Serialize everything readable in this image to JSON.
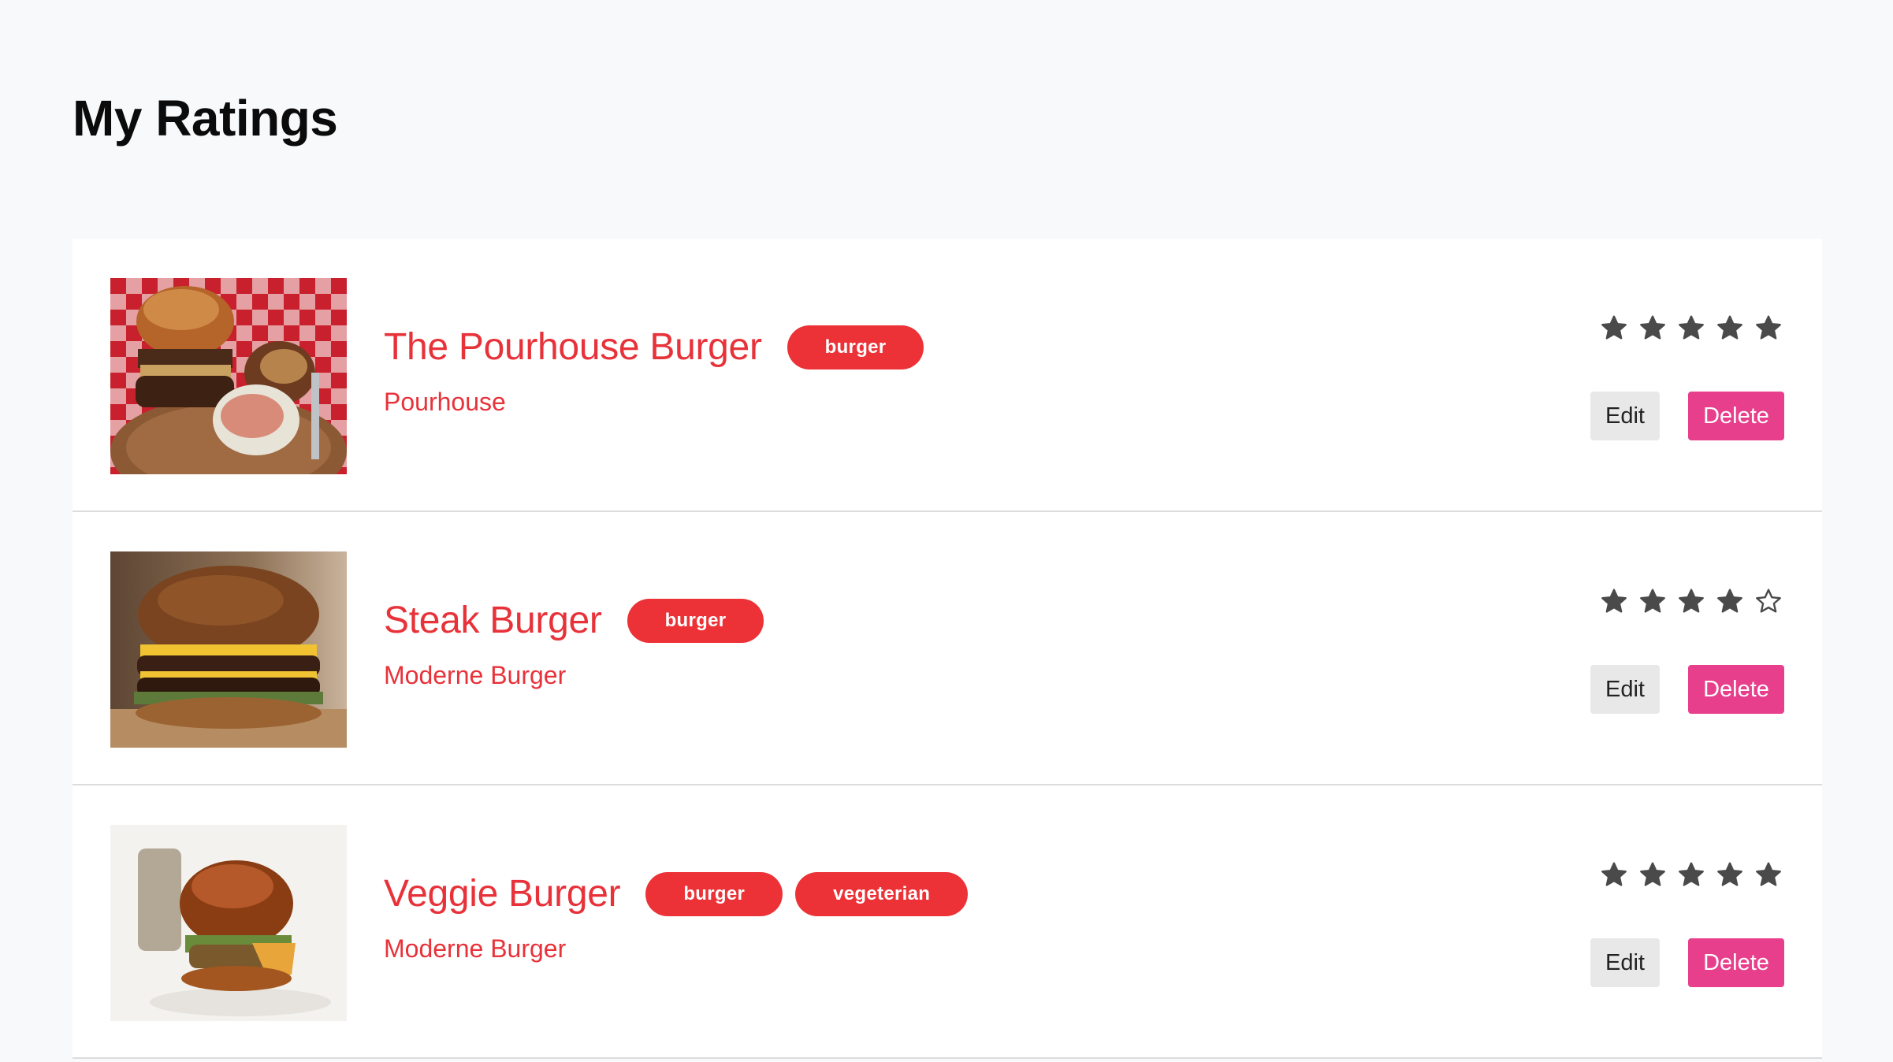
{
  "header": {
    "title": "My Ratings"
  },
  "colors": {
    "accent": "#e8323a",
    "tag_bg": "#ec3237",
    "delete_bg": "#e73f8c",
    "edit_bg": "#e8e8e8",
    "star": "#4a4a4a"
  },
  "ratings": [
    {
      "title": "The Pourhouse Burger",
      "tags": [
        "burger"
      ],
      "place": "Pourhouse",
      "rating": 5,
      "max_rating": 5,
      "edit_label": "Edit",
      "delete_label": "Delete"
    },
    {
      "title": "Steak Burger",
      "tags": [
        "burger"
      ],
      "place": "Moderne Burger",
      "rating": 4,
      "max_rating": 5,
      "edit_label": "Edit",
      "delete_label": "Delete"
    },
    {
      "title": "Veggie Burger",
      "tags": [
        "burger",
        "vegeterian"
      ],
      "place": "Moderne Burger",
      "rating": 5,
      "max_rating": 5,
      "edit_label": "Edit",
      "delete_label": "Delete"
    }
  ]
}
